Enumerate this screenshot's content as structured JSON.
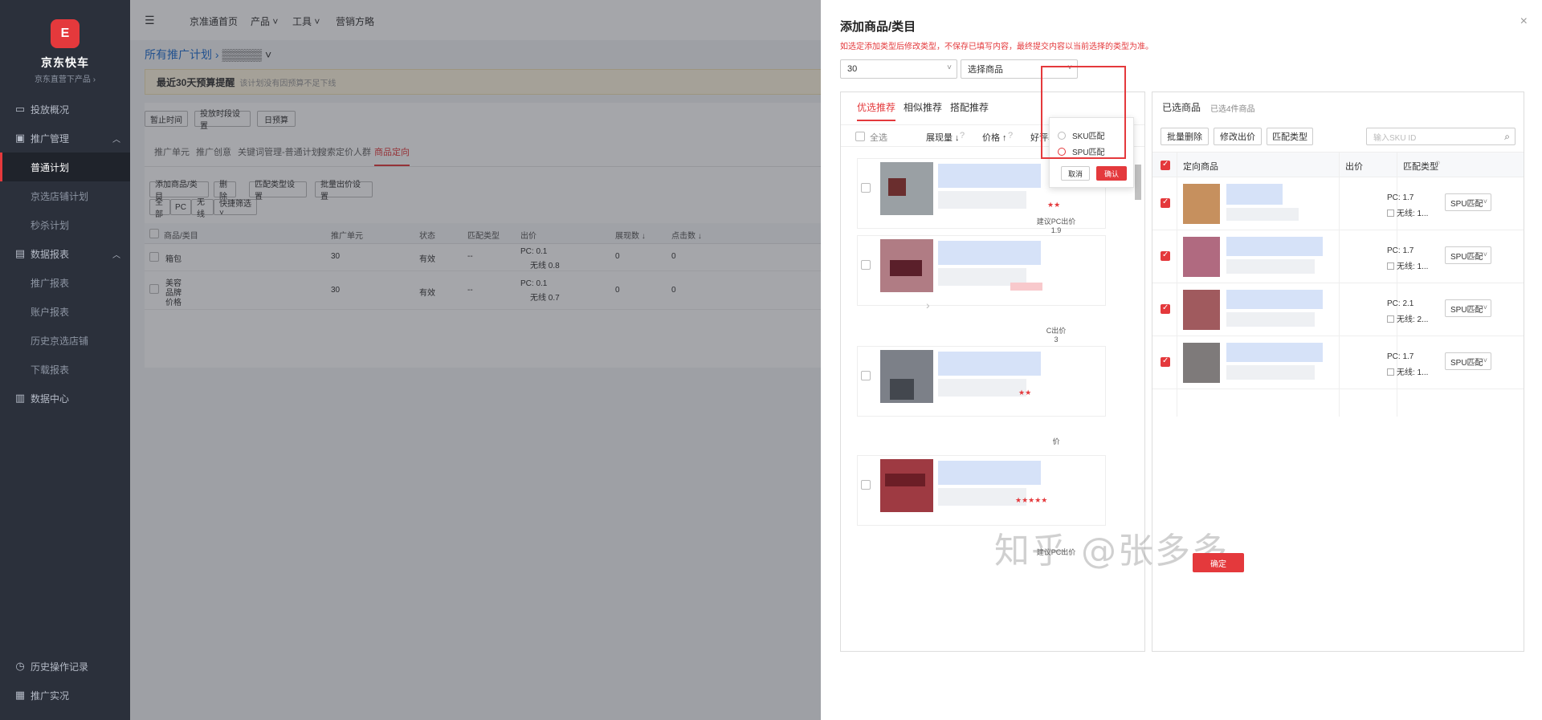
{
  "sidebar": {
    "logo_glyph": "E",
    "brand": "京东快车",
    "brand_sub": "京东直营下产品 ›",
    "items": [
      {
        "label": "投放概况",
        "icon": "monitor-icon"
      },
      {
        "label": "推广管理",
        "icon": "briefcase-icon"
      },
      {
        "label": "普通计划"
      },
      {
        "label": "京选店铺计划"
      },
      {
        "label": "秒杀计划"
      },
      {
        "label": "数据报表",
        "icon": "report-icon"
      },
      {
        "label": "推广报表"
      },
      {
        "label": "账户报表"
      },
      {
        "label": "历史京选店铺"
      },
      {
        "label": "下载报表"
      },
      {
        "label": "数据中心",
        "icon": "chart-icon"
      }
    ],
    "bottom": [
      {
        "label": "历史操作记录",
        "icon": "history-icon"
      },
      {
        "label": "推广实况",
        "icon": "live-icon"
      }
    ]
  },
  "topnav": {
    "menu_icon": "☰",
    "items": [
      "京准通首页",
      "产品 ˅",
      "工具 ˅",
      "营销方略"
    ]
  },
  "main": {
    "breadcrumb_root": "所有推广计划 ›",
    "breadcrumb_current": "▒▒▒▒▒ ˅",
    "warning_title": "最近30天预算提醒",
    "warning_text": "该计划没有因预算不足下线",
    "toolbar": [
      "暂止时间",
      "投放时段设置",
      "日预算"
    ],
    "tabs": [
      "推广单元",
      "推广创意",
      "关键词管理-普通计划",
      "搜索定价人群",
      "商品定向"
    ],
    "actions": [
      "添加商品/类目",
      "删除",
      "匹配类型设置",
      "批量出价设置"
    ],
    "filters": [
      "全部",
      "PC",
      "无线",
      "快捷筛选 ˅"
    ],
    "columns": [
      "商品/类目",
      "推广单元",
      "状态",
      "匹配类型",
      "出价",
      "展现数 ↓",
      "点击数 ↓"
    ],
    "rows": [
      {
        "name": "箱包",
        "unit": "30",
        "status": "有效",
        "match": "--",
        "pc": "PC: 0.1",
        "wx": "无线 0.8",
        "imp": "0",
        "clk": "0"
      },
      {
        "name": "美容",
        "name2": "品牌",
        "name3": "价格",
        "unit": "30",
        "status": "有效",
        "match": "--",
        "pc": "PC: 0.1",
        "wx": "无线 0.7",
        "imp": "0",
        "clk": "0"
      }
    ]
  },
  "drawer": {
    "title": "添加商品/类目",
    "close": "×",
    "note": "如选定添加类型后修改类型，不保存已填写内容，最终提交内容以当前选择的类型为准。",
    "unit_select": "30",
    "type_select": "选择商品",
    "left": {
      "tabs": [
        "优选推荐",
        "相似推荐",
        "搭配推荐"
      ],
      "select_all": "全选",
      "sort_imp": "展现量 ↓",
      "sort_price": "价格 ↑",
      "sort_rate": "好评率 ↑",
      "help": "?",
      "products": [
        {
          "stars": "★★",
          "sug1": "建议PC出价",
          "sug2": "1.9"
        },
        {
          "stars": "",
          "sug1": "C出价",
          "sug2": "3"
        },
        {
          "stars": "★★",
          "sug1": "价",
          "sug2": ""
        },
        {
          "stars": "★★★★★",
          "sug1": "建议PC出价",
          "sug2": ""
        }
      ]
    },
    "arrow": "›",
    "right": {
      "title": "已选商品",
      "subtitle": "已选4件商品",
      "buttons": [
        "批量删除",
        "修改出价",
        "匹配类型"
      ],
      "search_placeholder": "输入SKU ID",
      "search_icon": "search-icon",
      "columns": [
        "定向商品",
        "出价",
        "匹配类型"
      ],
      "rows": [
        {
          "pc": "PC: 1.7",
          "wx": "无线: 1...",
          "match": "SPU匹配"
        },
        {
          "pc": "PC: 1.7",
          "wx": "无线: 1...",
          "match": "SPU匹配"
        },
        {
          "pc": "PC: 2.1",
          "wx": "无线: 2...",
          "match": "SPU匹配"
        },
        {
          "pc": "PC: 1.7",
          "wx": "无线: 1...",
          "match": "SPU匹配"
        }
      ]
    },
    "popover": {
      "options": [
        "SKU匹配",
        "SPU匹配"
      ],
      "cancel": "取消",
      "confirm": "确认"
    },
    "ok": "确定"
  },
  "watermark": "知乎 @张多多",
  "colors": {
    "accent": "#e4393c",
    "sidebar": "#2b303b",
    "link": "#1f6fd1"
  }
}
